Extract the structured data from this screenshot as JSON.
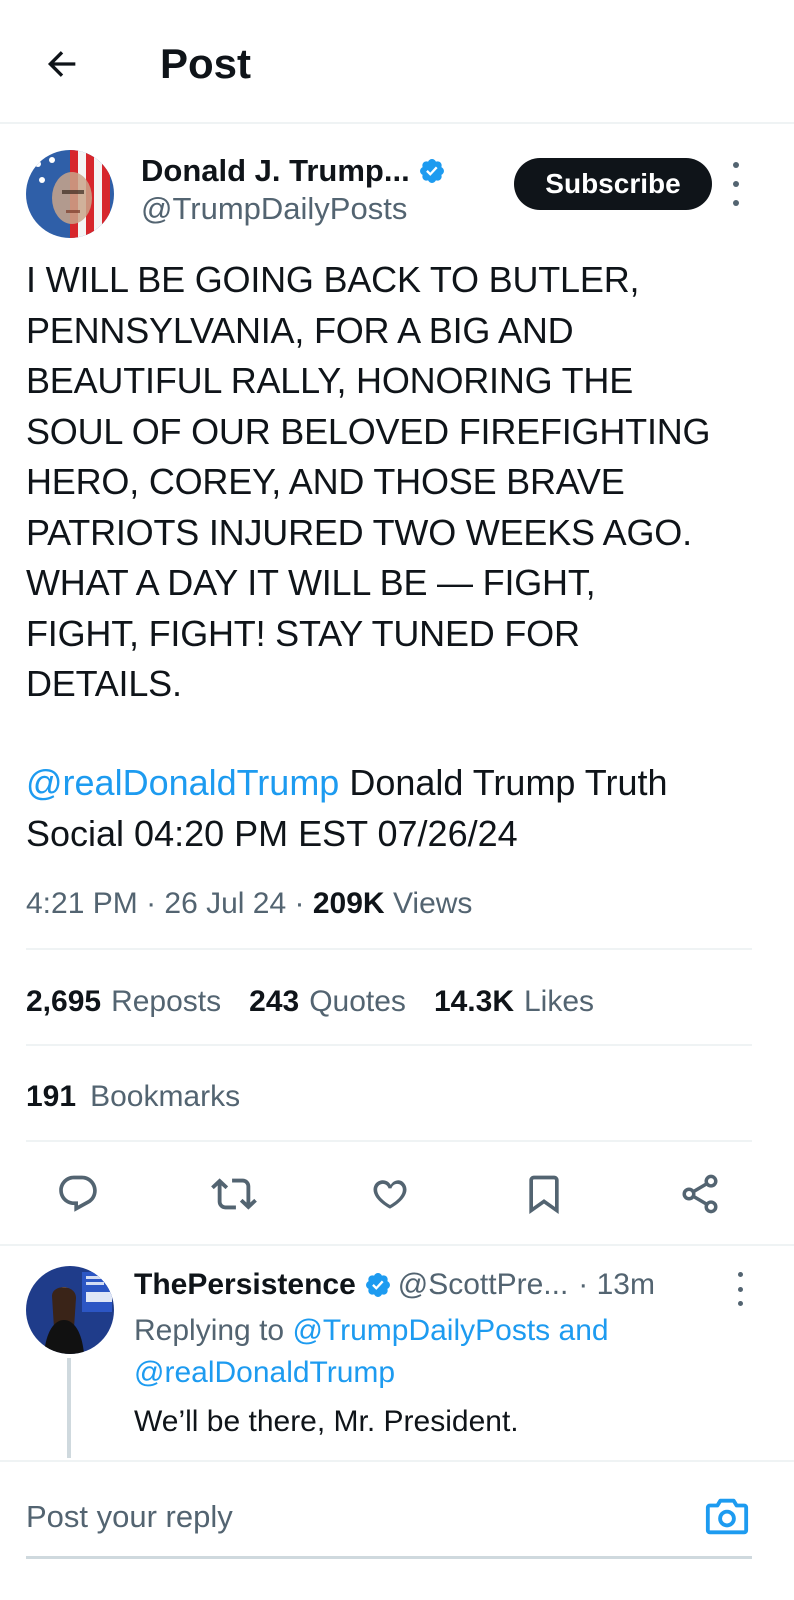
{
  "header": {
    "title": "Post",
    "back_icon": "arrow-left-icon"
  },
  "post": {
    "author": {
      "display_name": "Donald J. Trump...",
      "handle": "@TrumpDailyPosts",
      "verified": true
    },
    "subscribe_label": "Subscribe",
    "body": "I WILL BE GOING BACK TO BUTLER,\nPENNSYLVANIA, FOR A BIG AND\nBEAUTIFUL RALLY, HONORING THE\nSOUL OF OUR BELOVED FIREFIGHTING\nHERO, COREY, AND THOSE BRAVE\nPATRIOTS INJURED TWO WEEKS AGO.\nWHAT A DAY IT WILL BE — FIGHT,\nFIGHT, FIGHT! STAY TUNED FOR\nDETAILS.",
    "source_mention": "@realDonaldTrump",
    "source_text": " Donald Trump Truth Social 04:20 PM EST 07/26/24",
    "time": "4:21 PM",
    "date": "26 Jul 24",
    "views_count": "209K",
    "views_label": "Views",
    "separator": "·",
    "stats": {
      "reposts_count": "2,695",
      "reposts_label": "Reposts",
      "quotes_count": "243",
      "quotes_label": "Quotes",
      "likes_count": "14.3K",
      "likes_label": "Likes",
      "bookmarks_count": "191",
      "bookmarks_label": "Bookmarks"
    },
    "actions": [
      "reply-icon",
      "repost-icon",
      "like-icon",
      "bookmark-icon",
      "share-icon"
    ]
  },
  "reply": {
    "display_name": "ThePersistence",
    "verified": true,
    "handle": "@ScottPre...",
    "time": "· 13m",
    "replying_prefix": "Replying to ",
    "replying_to_1": "@TrumpDailyPosts",
    "replying_and": " and ",
    "replying_to_2": "@realDonaldTrump",
    "text": "We’ll be there, Mr. President."
  },
  "composer": {
    "placeholder": "Post your reply",
    "camera_icon": "camera-icon"
  },
  "colors": {
    "accent": "#1d9bf0",
    "text": "#0f1419",
    "muted": "#536471",
    "divider": "#eff3f4"
  }
}
